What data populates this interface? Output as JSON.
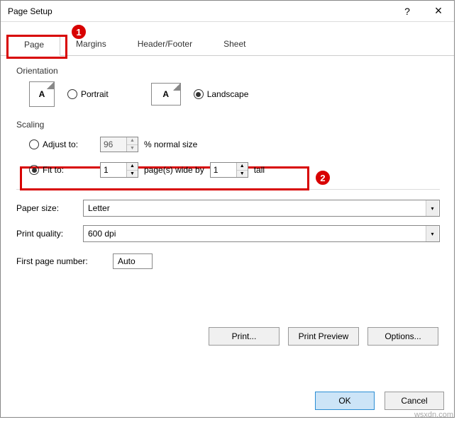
{
  "titlebar": {
    "title": "Page Setup",
    "help": "?",
    "close": "×"
  },
  "tabs": {
    "page": "Page",
    "margins": "Margins",
    "headerfooter": "Header/Footer",
    "sheet": "Sheet"
  },
  "orientation": {
    "label": "Orientation",
    "portrait": "Portrait",
    "landscape": "Landscape",
    "icon_a": "A"
  },
  "scaling": {
    "label": "Scaling",
    "adjust_to": "Adjust to:",
    "adjust_value": "96",
    "adjust_suffix": "% normal size",
    "fit_to": "Fit to:",
    "fit_wide": "1",
    "fit_mid": "page(s) wide by",
    "fit_tall": "1",
    "fit_suffix": "tall"
  },
  "paper": {
    "label": "Paper size:",
    "value": "Letter"
  },
  "quality": {
    "label": "Print quality:",
    "value": "600 dpi"
  },
  "firstpage": {
    "label": "First page number:",
    "value": "Auto"
  },
  "buttons": {
    "print": "Print...",
    "preview": "Print Preview",
    "options": "Options...",
    "ok": "OK",
    "cancel": "Cancel"
  },
  "annotations": {
    "a1": "1",
    "a2": "2"
  },
  "watermark": "wsxdn.com"
}
